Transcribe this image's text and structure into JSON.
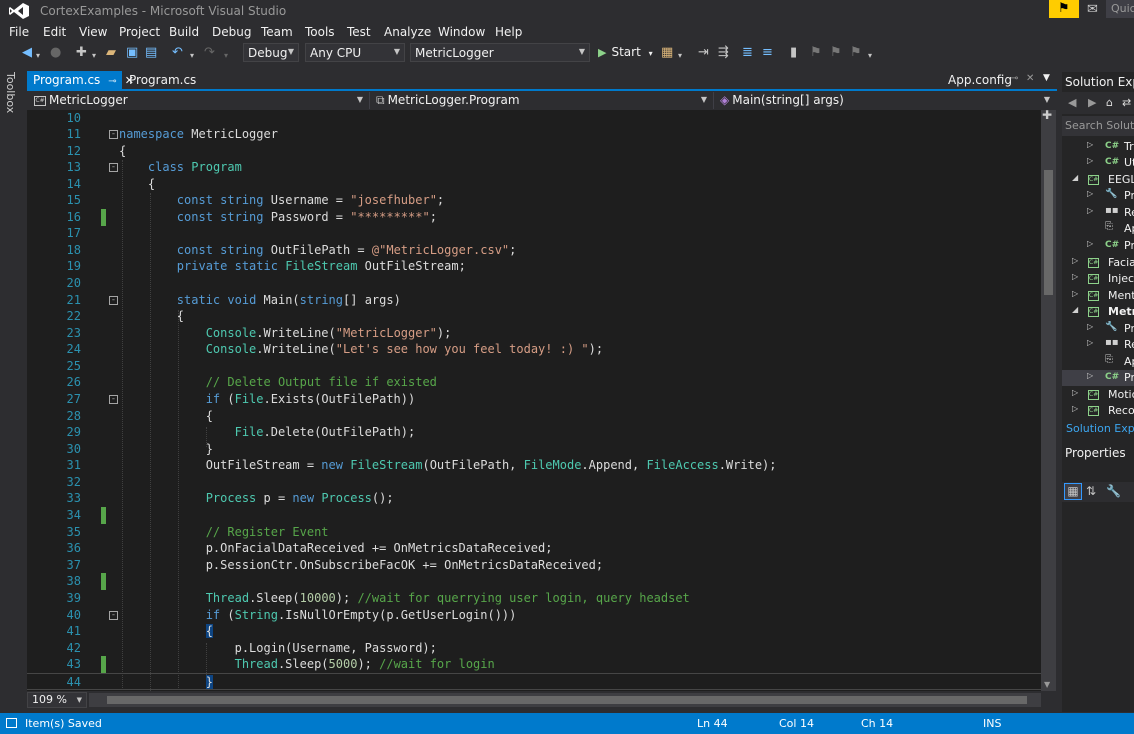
{
  "window": {
    "title": "CortexExamples - Microsoft Visual Studio",
    "quick_launch_placeholder": "Quick Launch",
    "notification_icon": "flag-icon",
    "accent": "#007acc"
  },
  "menu": [
    "File",
    "Edit",
    "View",
    "Project",
    "Build",
    "Debug",
    "Team",
    "Tools",
    "Test",
    "Analyze",
    "Window",
    "Help"
  ],
  "toolbar": {
    "configuration": "Debug",
    "platform": "Any CPU",
    "startup_project": "MetricLogger",
    "start_label": "Start"
  },
  "toolbox_label": "Toolbox",
  "tabs": [
    {
      "label": "Program.cs",
      "active": true
    },
    {
      "label": "Program.cs",
      "active": false
    }
  ],
  "tab_right": "App.config",
  "navbar": {
    "project": "MetricLogger",
    "type": "MetricLogger.Program",
    "member": "Main(string[] args)"
  },
  "code_lines": [
    {
      "n": "10",
      "text": ""
    },
    {
      "n": "11",
      "text": "namespace MetricLogger"
    },
    {
      "n": "12",
      "text": "{"
    },
    {
      "n": "13",
      "text": "    class Program"
    },
    {
      "n": "14",
      "text": "    {"
    },
    {
      "n": "15",
      "text": "        const string Username = \"josefhuber\";"
    },
    {
      "n": "16",
      "text": "        const string Password = \"*********\";"
    },
    {
      "n": "17",
      "text": ""
    },
    {
      "n": "18",
      "text": "        const string OutFilePath = @\"MetricLogger.csv\";"
    },
    {
      "n": "19",
      "text": "        private static FileStream OutFileStream;"
    },
    {
      "n": "20",
      "text": ""
    },
    {
      "n": "21",
      "text": "        static void Main(string[] args)"
    },
    {
      "n": "22",
      "text": "        {"
    },
    {
      "n": "23",
      "text": "            Console.WriteLine(\"MetricLogger\");"
    },
    {
      "n": "24",
      "text": "            Console.WriteLine(\"Let's see how you feel today! :) \");"
    },
    {
      "n": "25",
      "text": ""
    },
    {
      "n": "26",
      "text": "            // Delete Output file if existed"
    },
    {
      "n": "27",
      "text": "            if (File.Exists(OutFilePath))"
    },
    {
      "n": "28",
      "text": "            {"
    },
    {
      "n": "29",
      "text": "                File.Delete(OutFilePath);"
    },
    {
      "n": "30",
      "text": "            }"
    },
    {
      "n": "31",
      "text": "            OutFileStream = new FileStream(OutFilePath, FileMode.Append, FileAccess.Write);"
    },
    {
      "n": "32",
      "text": ""
    },
    {
      "n": "33",
      "text": "            Process p = new Process();"
    },
    {
      "n": "34",
      "text": ""
    },
    {
      "n": "35",
      "text": "            // Register Event"
    },
    {
      "n": "36",
      "text": "            p.OnFacialDataReceived += OnMetricsDataReceived;"
    },
    {
      "n": "37",
      "text": "            p.SessionCtr.OnSubscribeFacOK += OnMetricsDataReceived;"
    },
    {
      "n": "38",
      "text": ""
    },
    {
      "n": "39",
      "text": "            Thread.Sleep(10000); //wait for querrying user login, query headset"
    },
    {
      "n": "40",
      "text": "            if (String.IsNullOrEmpty(p.GetUserLogin()))"
    },
    {
      "n": "41",
      "text": "            {"
    },
    {
      "n": "42",
      "text": "                p.Login(Username, Password);"
    },
    {
      "n": "43",
      "text": "                Thread.Sleep(5000); //wait for login"
    },
    {
      "n": "44",
      "text": "            }"
    }
  ],
  "zoom": "109 %",
  "solution_explorer": {
    "title": "Solution Explorer",
    "search_placeholder": "Search Solution Explorer",
    "items": [
      {
        "label": "TrainingHelper.cs"
      },
      {
        "label": "Utils.cs"
      },
      {
        "label": "EEGLogger"
      },
      {
        "label": "Properties"
      },
      {
        "label": "References"
      },
      {
        "label": "App.config"
      },
      {
        "label": "Program.cs"
      },
      {
        "label": "FacialExpressionTraining"
      },
      {
        "label": "InjectMarker"
      },
      {
        "label": "MentalCommandTraining"
      },
      {
        "label": "MetricLogger"
      },
      {
        "label": "Properties"
      },
      {
        "label": "References"
      },
      {
        "label": "App.config"
      },
      {
        "label": "Program.cs"
      },
      {
        "label": "MotionLogger"
      },
      {
        "label": "RecordData"
      }
    ],
    "bottom_tab": "Solution Explorer"
  },
  "properties": {
    "title": "Properties"
  },
  "status": {
    "message": "Item(s) Saved",
    "ln": "Ln 44",
    "col": "Col 14",
    "ch": "Ch 14",
    "mode": "INS"
  }
}
